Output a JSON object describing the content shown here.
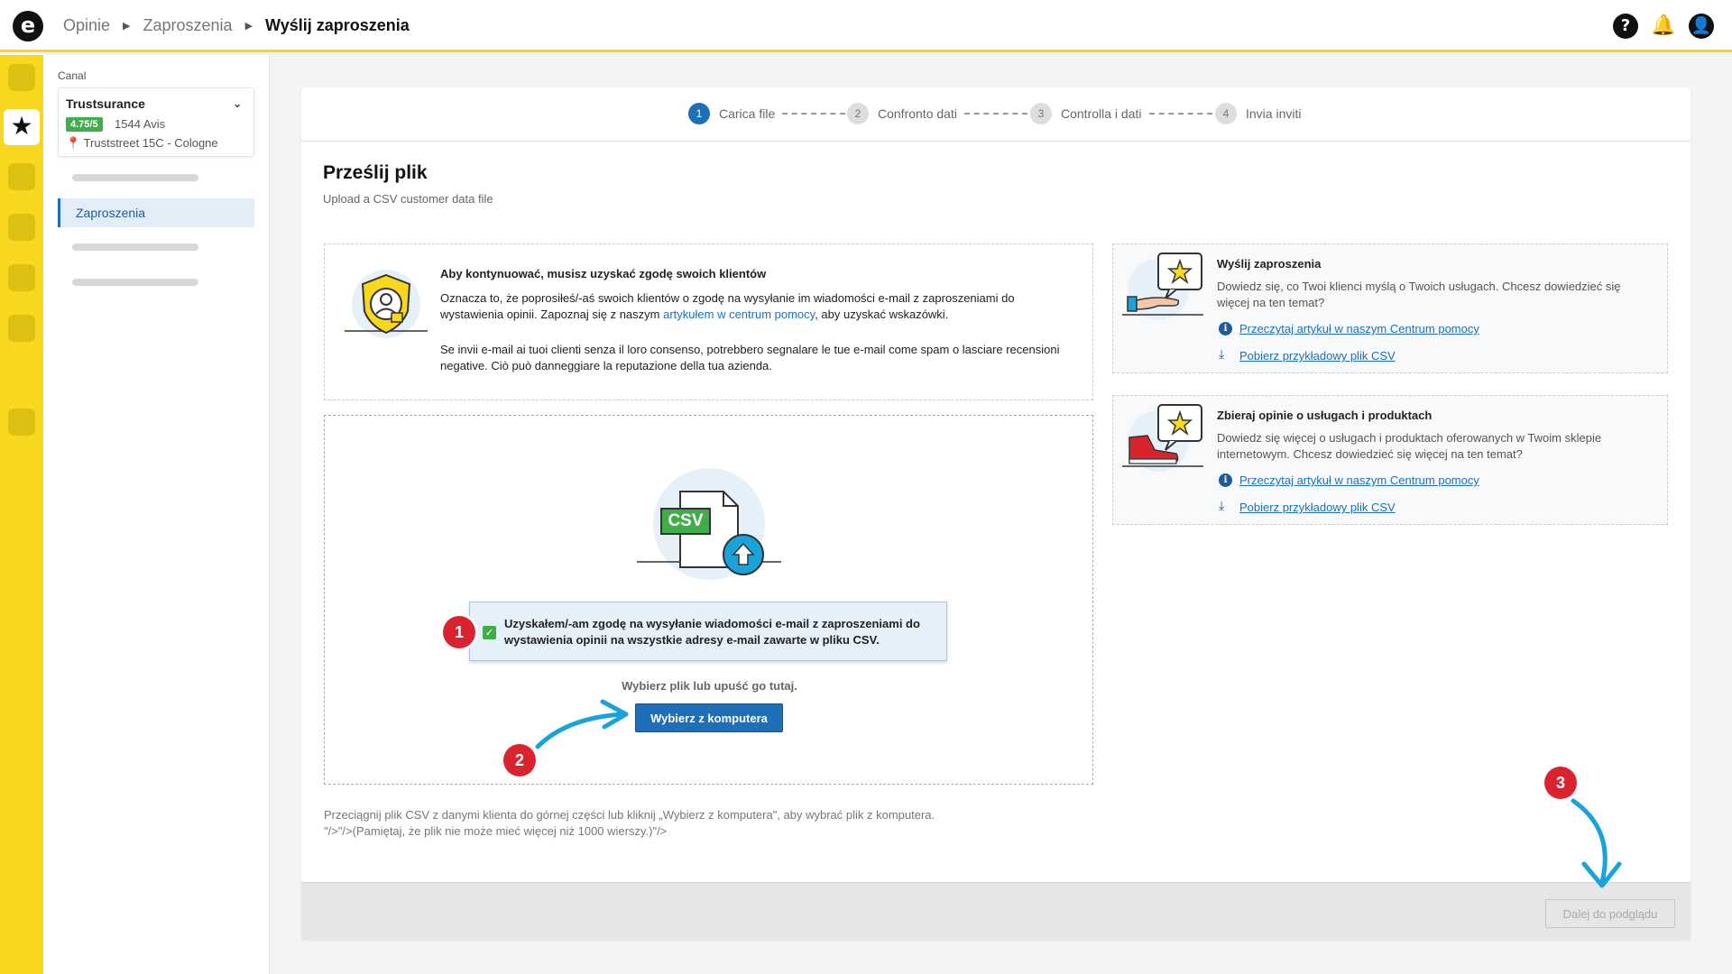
{
  "topbar": {
    "logo_glyph": "e",
    "breadcrumbs": [
      "Opinie",
      "Zaproszenia",
      "Wyślij zaproszenia"
    ],
    "breadcrumb_sep": "▶",
    "icons": [
      "help-icon",
      "bell-icon",
      "user-icon"
    ],
    "help_glyph": "?",
    "bell_glyph": "🔔",
    "user_glyph": "👤"
  },
  "rail": {
    "active_glyph": "★"
  },
  "sidebar": {
    "label": "Canal",
    "company": {
      "name": "Trustsurance",
      "rating": "4.75/5",
      "reviews": "1544 Avis",
      "address": "📍 Truststreet 15C - Cologne",
      "chevron": "⌄"
    },
    "active_item": "Zaproszenia"
  },
  "stepper": [
    {
      "num": "1",
      "label": "Carica file"
    },
    {
      "num": "2",
      "label": "Confronto dati"
    },
    {
      "num": "3",
      "label": "Controlla i dati"
    },
    {
      "num": "4",
      "label": "Invia inviti"
    }
  ],
  "main": {
    "title": "Prześlij plik",
    "subtitle": "Upload a CSV customer data file",
    "consent": {
      "heading": "Aby kontynuować, musisz uzyskać zgodę swoich klientów",
      "p1_before": "Oznacza to, że poprosiłeś/-aś swoich klientów o zgodę na wysyłanie im wiadomości e-mail z zaproszeniami do wystawienia opinii. Zapoznaj się z naszym ",
      "p1_link": "artykułem w centrum pomocy",
      "p1_after": ", aby uzyskać wskazówki.",
      "p2": "Se invii e-mail ai tuoi clienti senza il loro consenso, potrebbero segnalare le tue e-mail come spam o lasciare recensioni negative. Ciò può danneggiare la reputazione della tua azienda."
    },
    "drop": {
      "csv_label": "CSV",
      "checkbox_text": "Uzyskałem/-am zgodę na wysyłanie wiadomości e-mail z zaproszeniami do wystawienia opinii na wszystkie adresy e-mail zawarte w pliku CSV.",
      "checkbox_checked": true,
      "hint": "Wybierz plik lub upuść go tutaj.",
      "choose_button": "Wybierz z komputera"
    },
    "note_line1": "Przeciągnij plik CSV z danymi klienta do górnej części lub kliknij „Wybierz z komputera\", aby wybrać plik z komputera.",
    "note_line2": "\"/>\"/>(Pamiętaj, że plik nie może mieć więcej niż 1000 wierszy.)\"/>",
    "next_button": "Dalej do podglądu"
  },
  "panels": [
    {
      "title": "Wyślij zaproszenia",
      "desc": "Dowiedz się, co Twoi klienci myślą o Twoich usługach. Chcesz dowiedzieć się więcej na ten temat?",
      "link1": "Przeczytaj artykuł w naszym Centrum pomocy",
      "link2": "Pobierz przykładowy plik CSV"
    },
    {
      "title": "Zbieraj opinie o usługach i produktach",
      "desc": "Dowiedz się więcej o usługach i produktach oferowanych w Twoim sklepie internetowym. Chcesz dowiedzieć się więcej na ten temat?",
      "link1": "Przeczytaj artykuł w naszym Centrum pomocy",
      "link2": "Pobierz przykładowy plik CSV"
    }
  ],
  "annotations": [
    "1",
    "2",
    "3"
  ],
  "colors": {
    "brand_yellow": "#f7d81e",
    "primary_blue": "#1e6fb8",
    "rating_green": "#3fae49",
    "marker_red": "#d9242f",
    "arrow_cyan": "#1aa3d8"
  }
}
